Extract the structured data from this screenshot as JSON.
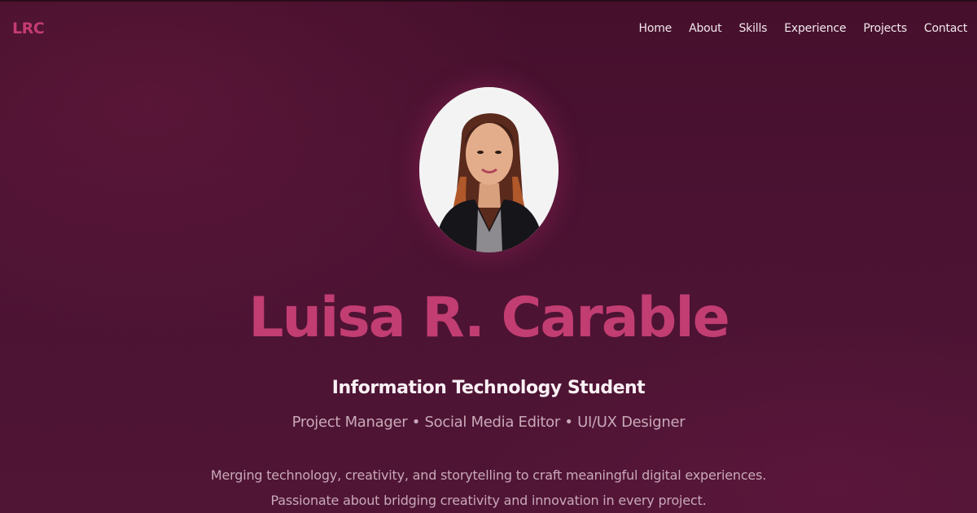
{
  "brand": {
    "logo": "LRC",
    "accent_color": "#c13d72",
    "background_color": "#4b1232"
  },
  "nav": {
    "items": [
      {
        "label": "Home"
      },
      {
        "label": "About"
      },
      {
        "label": "Skills"
      },
      {
        "label": "Experience"
      },
      {
        "label": "Projects"
      },
      {
        "label": "Contact"
      }
    ]
  },
  "hero": {
    "avatar_icon": "profile-photo",
    "name": "Luisa R. Carable",
    "title": "Information Technology Student",
    "roles": "Project Manager • Social Media Editor • UI/UX Designer",
    "description": "Merging technology, creativity, and storytelling to craft meaningful digital experiences. Passionate about bridging creativity and innovation in every project."
  }
}
